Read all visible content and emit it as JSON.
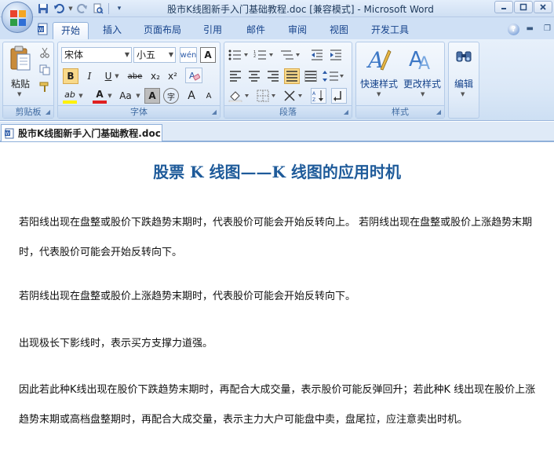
{
  "window": {
    "title": "股市K线图新手入门基础教程.doc [兼容模式] - Microsoft Word"
  },
  "tabs": [
    {
      "label": "开始"
    },
    {
      "label": "插入"
    },
    {
      "label": "页面布局"
    },
    {
      "label": "引用"
    },
    {
      "label": "邮件"
    },
    {
      "label": "审阅"
    },
    {
      "label": "视图"
    },
    {
      "label": "开发工具"
    }
  ],
  "help_label": "?",
  "ribbon": {
    "clipboard": {
      "paste_label": "粘贴",
      "group_label": "剪贴板"
    },
    "font": {
      "font_name": "宋体",
      "font_size": "小五",
      "group_label": "字体",
      "bold": "B",
      "italic": "I",
      "underline": "U",
      "strike": "abe",
      "subscript": "x₂",
      "superscript": "x²",
      "change_case": "Aa",
      "char_shading": "A",
      "grow": "A",
      "shrink": "A",
      "highlight": "ab",
      "font_color": "A"
    },
    "paragraph": {
      "group_label": "段落"
    },
    "styles": {
      "quick_styles_label": "快速样式",
      "change_styles_label": "更改样式",
      "group_label": "样式"
    },
    "editing": {
      "label": "编辑"
    }
  },
  "document": {
    "tab_label": "股市K线图新手入门基础教程.doc",
    "title": "股票 K 线图——K 线图的应用时机",
    "paragraphs": [
      "若阳线出现在盘整或股价下跌趋势末期时，代表股价可能会开始反转向上。 若阴线出现在盘整或股价上涨趋势末期时，代表股价可能会开始反转向下。",
      "若阴线出现在盘整或股价上涨趋势末期时，代表股价可能会开始反转向下。",
      "出现极长下影线时，表示买方支撑力道强。",
      "因此若此种K线出现在股价下跌趋势末期时，再配合大成交量，表示股价可能反弹回升；若此种K 线出现在股价上涨趋势末期或高档盘整期时，再配合大成交量，表示主力大户可能盘中卖，盘尾拉，应注意卖出时机。"
    ]
  }
}
